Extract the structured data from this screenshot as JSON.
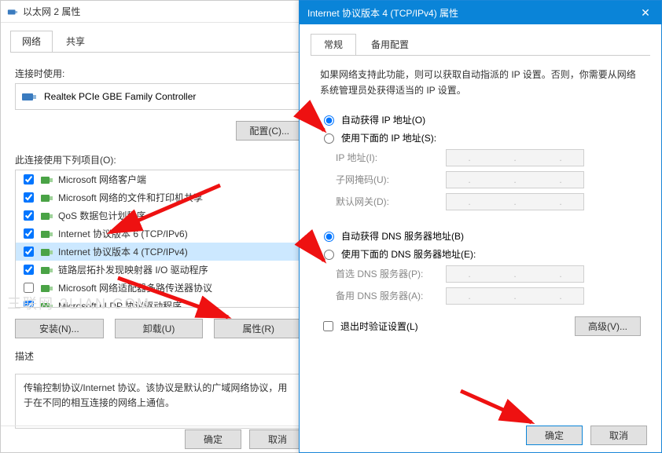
{
  "left": {
    "title": "以太网 2 属性",
    "tabs": {
      "network": "网络",
      "share": "共享"
    },
    "connect_using_label": "连接时使用:",
    "adapter": "Realtek PCIe GBE Family Controller",
    "configure_btn": "配置(C)...",
    "items_label": "此连接使用下列项目(O):",
    "items": [
      {
        "label": "Microsoft 网络客户端",
        "checked": true
      },
      {
        "label": "Microsoft 网络的文件和打印机共享",
        "checked": true
      },
      {
        "label": "QoS 数据包计划程序",
        "checked": true
      },
      {
        "label": "Internet 协议版本 6 (TCP/IPv6)",
        "checked": true
      },
      {
        "label": "Internet 协议版本 4 (TCP/IPv4)",
        "checked": true,
        "highlight": true
      },
      {
        "label": "链路层拓扑发现映射器 I/O 驱动程序",
        "checked": true
      },
      {
        "label": "Microsoft 网络适配器多路传送器协议",
        "checked": false
      },
      {
        "label": "Microsoft LLDP 协议驱动程序",
        "checked": true
      }
    ],
    "install_btn": "安装(N)...",
    "uninstall_btn": "卸载(U)",
    "properties_btn": "属性(R)",
    "desc_label": "描述",
    "desc_text": "传输控制协议/Internet 协议。该协议是默认的广域网络协议，用于在不同的相互连接的网络上通信。",
    "ok_btn": "确定",
    "cancel_btn": "取消",
    "watermark": "三联网 3LIAN.COM"
  },
  "right": {
    "title": "Internet 协议版本 4 (TCP/IPv4) 属性",
    "tabs": {
      "general": "常规",
      "alt": "备用配置"
    },
    "info": "如果网络支持此功能，则可以获取自动指派的 IP 设置。否则，你需要从网络系统管理员处获得适当的 IP 设置。",
    "radio_ip_auto": "自动获得 IP 地址(O)",
    "radio_ip_manual": "使用下面的 IP 地址(S):",
    "ip_label": "IP 地址(I):",
    "mask_label": "子网掩码(U):",
    "gw_label": "默认网关(D):",
    "radio_dns_auto": "自动获得 DNS 服务器地址(B)",
    "radio_dns_manual": "使用下面的 DNS 服务器地址(E):",
    "dns1_label": "首选 DNS 服务器(P):",
    "dns2_label": "备用 DNS 服务器(A):",
    "chk_validate": "退出时验证设置(L)",
    "advanced_btn": "高级(V)...",
    "ok_btn": "确定",
    "cancel_btn": "取消"
  }
}
